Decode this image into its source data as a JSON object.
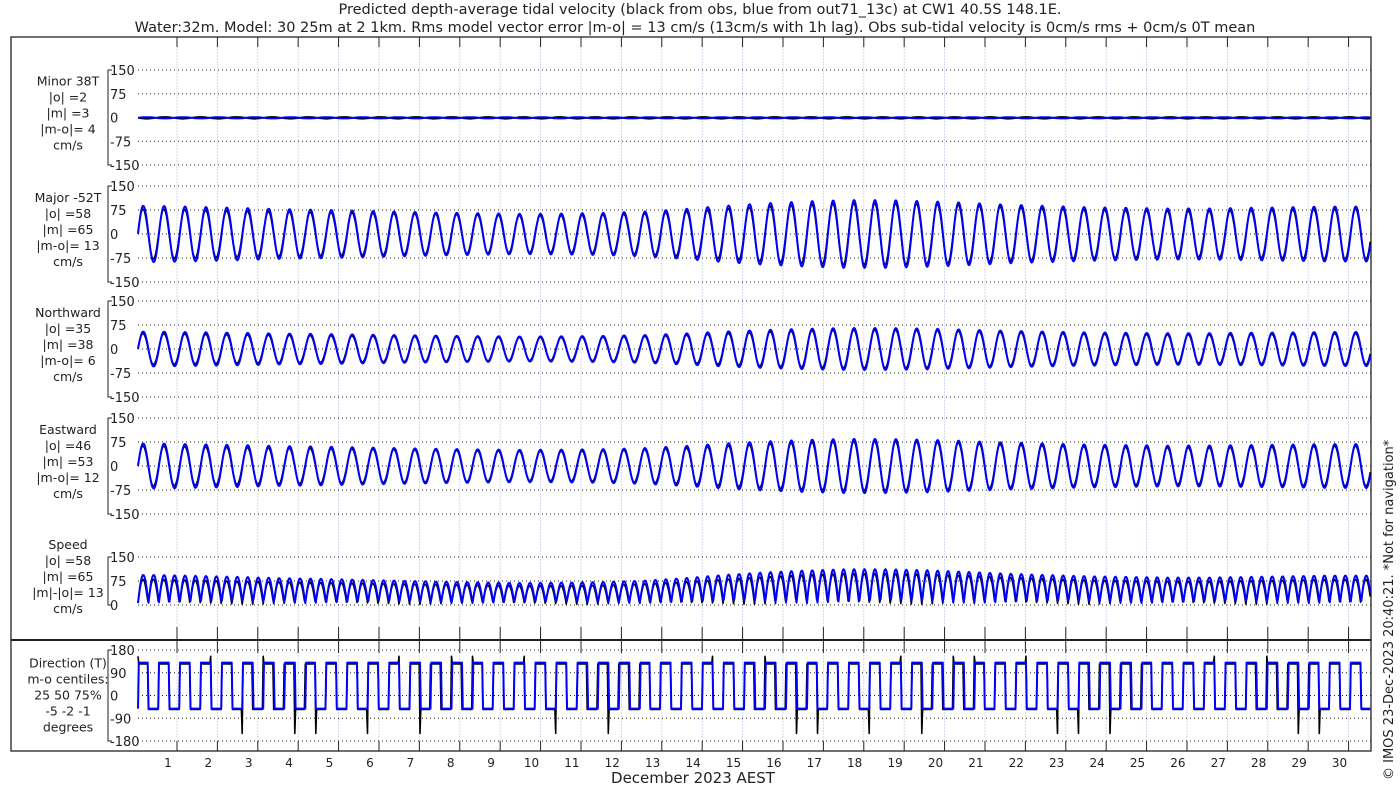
{
  "chart_data": {
    "type": "line",
    "title_line1": "Predicted depth-average tidal velocity (black from obs, blue from out71_13c) at CW1 40.5S 148.1E.",
    "title_line2": "Water:32m. Model: 30 25m at 2 1km. Rms model vector error |m-o| = 13 cm/s (13cm/s with 1h lag). Obs sub-tidal velocity is 0cm/s rms + 0cm/s 0T mean",
    "xlabel": "December 2023 AEST",
    "x_ticks": [
      "1",
      "2",
      "3",
      "4",
      "5",
      "6",
      "7",
      "8",
      "9",
      "10",
      "11",
      "12",
      "13",
      "14",
      "15",
      "16",
      "17",
      "18",
      "19",
      "20",
      "21",
      "22",
      "23",
      "24",
      "25",
      "26",
      "27",
      "28",
      "29",
      "30"
    ],
    "footer": "© IMOS 23-Dec-2023 20:40:21. *Not for navigation*",
    "series_colors": {
      "obs": "#000000",
      "model": "#0000ff"
    },
    "tidal_period_hours": 12.42,
    "major_daily_amplitude_obs": [
      78,
      75,
      72,
      70,
      68,
      66,
      64,
      62,
      60,
      58,
      58,
      60,
      64,
      70,
      78,
      86,
      92,
      96,
      96,
      94,
      90,
      84,
      80,
      76,
      74,
      72,
      72,
      74,
      76,
      78
    ],
    "major_daily_amplitude_model": [
      88,
      85,
      82,
      78,
      76,
      73,
      70,
      67,
      65,
      63,
      64,
      66,
      70,
      78,
      88,
      96,
      102,
      106,
      106,
      103,
      98,
      92,
      88,
      84,
      82,
      80,
      80,
      82,
      84,
      86
    ],
    "panels": [
      {
        "label": [
          "Minor 38T",
          "|o| =2",
          "|m| =3",
          "|m-o|= 4",
          "cm/s"
        ],
        "yticks": [
          "150",
          "75",
          "0",
          "-75",
          "-150"
        ],
        "ylim": [
          -150,
          150
        ],
        "scale": 0.04,
        "kind": "minor"
      },
      {
        "label": [
          "Major -52T",
          "|o| =58",
          "|m| =65",
          "|m-o|= 13",
          "cm/s"
        ],
        "yticks": [
          "150",
          "75",
          "0",
          "-75",
          "-150"
        ],
        "ylim": [
          -150,
          150
        ],
        "scale": 1.0,
        "kind": "major"
      },
      {
        "label": [
          "Northward",
          "|o| =35",
          "|m| =38",
          "|m-o|= 6",
          "cm/s"
        ],
        "yticks": [
          "150",
          "75",
          "0",
          "-75",
          "-150"
        ],
        "ylim": [
          -150,
          150
        ],
        "scale": 0.62,
        "kind": "north"
      },
      {
        "label": [
          "Eastward",
          "|o| =46",
          "|m| =53",
          "|m-o|= 12",
          "cm/s"
        ],
        "yticks": [
          "150",
          "75",
          "0",
          "-75",
          "-150"
        ],
        "ylim": [
          -150,
          150
        ],
        "scale": 0.8,
        "kind": "east"
      },
      {
        "label": [
          "Speed",
          "|o| =58",
          "|m| =65",
          "|m|-|o|= 13",
          "cm/s"
        ],
        "yticks": [
          "150",
          "75",
          "0"
        ],
        "ylim": [
          0,
          150
        ],
        "scale": 1.0,
        "kind": "speed"
      },
      {
        "label": [
          "Direction (T)",
          "m-o centiles:",
          "25  50  75%",
          "-5 -2 -1",
          "degrees"
        ],
        "yticks": [
          "180",
          "90",
          "0",
          "-90",
          "-180"
        ],
        "ylim": [
          -180,
          180
        ],
        "scale": 1.0,
        "kind": "dir"
      }
    ]
  }
}
